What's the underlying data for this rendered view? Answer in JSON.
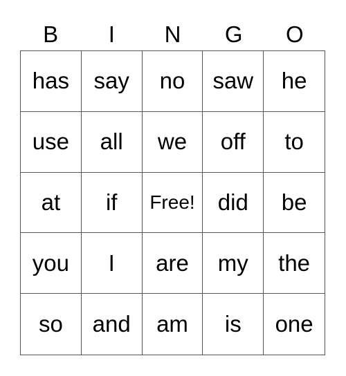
{
  "card": {
    "header": [
      "B",
      "I",
      "N",
      "G",
      "O"
    ],
    "rows": [
      [
        "has",
        "say",
        "no",
        "saw",
        "he"
      ],
      [
        "use",
        "all",
        "we",
        "off",
        "to"
      ],
      [
        "at",
        "if",
        "Free!",
        "did",
        "be"
      ],
      [
        "you",
        "I",
        "are",
        "my",
        "the"
      ],
      [
        "so",
        "and",
        "am",
        "is",
        "one"
      ]
    ]
  }
}
